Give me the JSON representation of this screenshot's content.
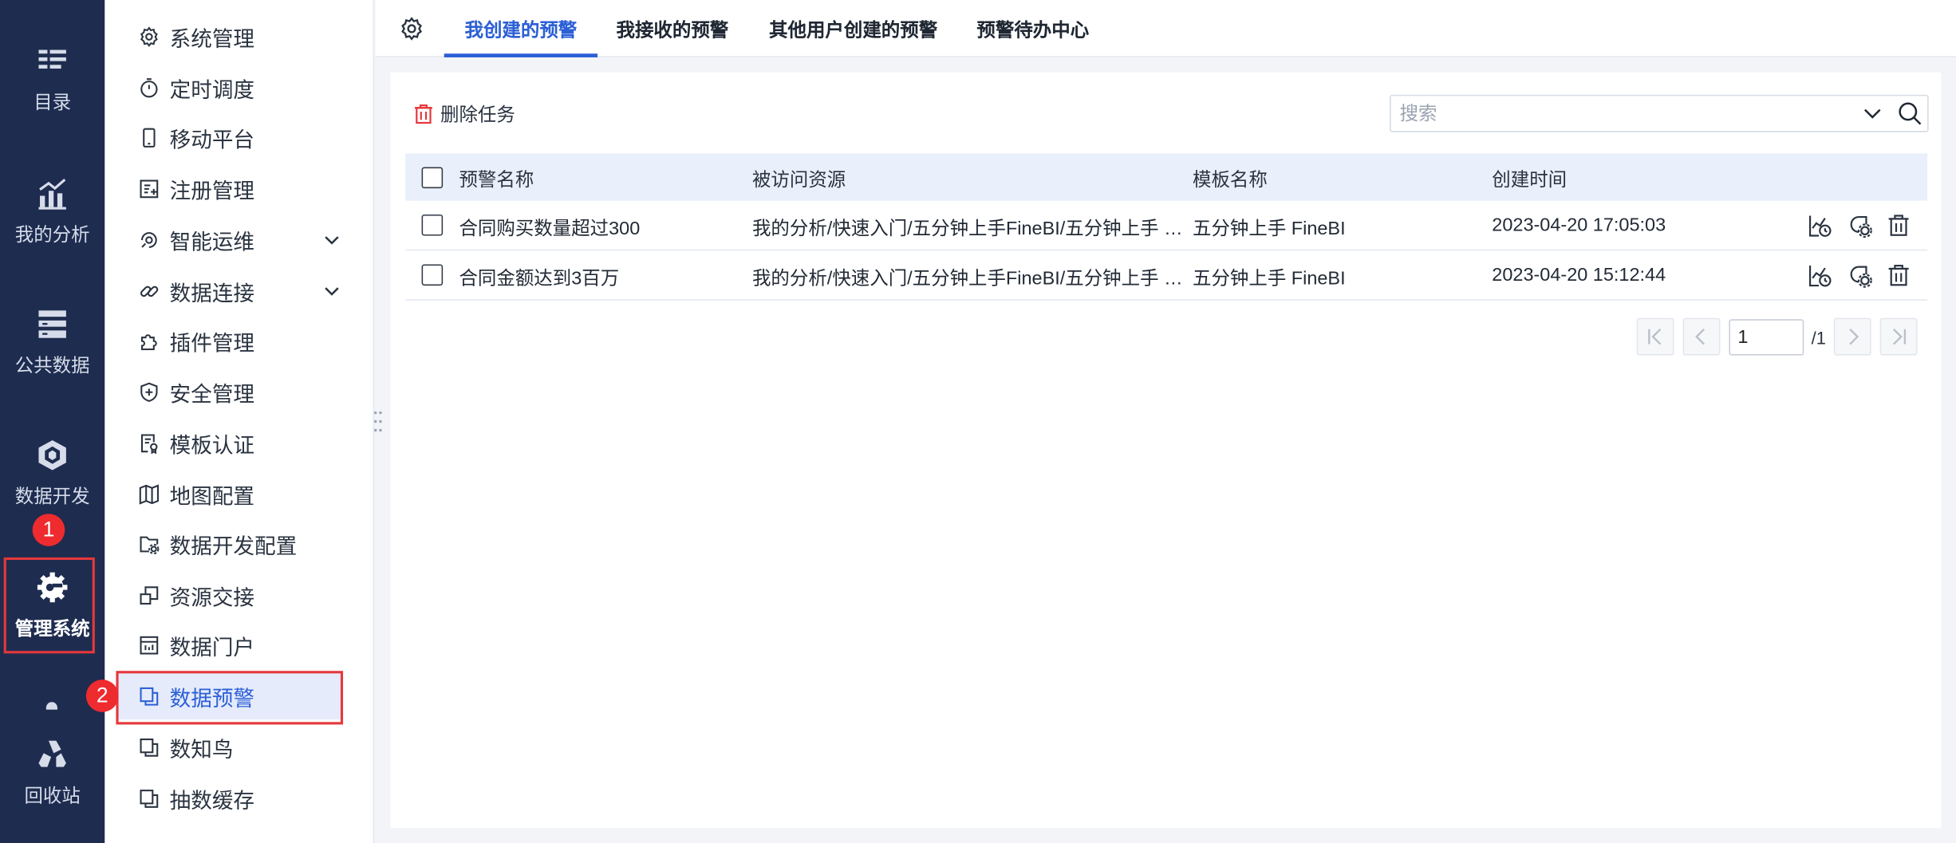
{
  "rail": {
    "items": [
      {
        "label": "目录",
        "icon": "catalog-icon"
      },
      {
        "label": "我的分析",
        "icon": "analysis-icon"
      },
      {
        "label": "公共数据",
        "icon": "public-data-icon"
      },
      {
        "label": "数据开发",
        "icon": "data-dev-icon"
      },
      {
        "label": "管理系统",
        "icon": "gear-system-icon"
      },
      {
        "label": "回收站",
        "icon": "recycle-icon"
      }
    ],
    "active": "管理系统"
  },
  "annotations": {
    "badge1": "1",
    "badge2": "2",
    "color": "#ee2b2f"
  },
  "menu": {
    "items": [
      {
        "label": "系统管理",
        "icon": "gear-icon"
      },
      {
        "label": "定时调度",
        "icon": "stopwatch-icon"
      },
      {
        "label": "移动平台",
        "icon": "mobile-icon"
      },
      {
        "label": "注册管理",
        "icon": "register-icon"
      },
      {
        "label": "智能运维",
        "icon": "ops-icon",
        "expandable": true
      },
      {
        "label": "数据连接",
        "icon": "link-icon",
        "expandable": true
      },
      {
        "label": "插件管理",
        "icon": "plugin-icon"
      },
      {
        "label": "安全管理",
        "icon": "shield-icon"
      },
      {
        "label": "模板认证",
        "icon": "certificate-icon"
      },
      {
        "label": "地图配置",
        "icon": "map-icon"
      },
      {
        "label": "数据开发配置",
        "icon": "folder-gear-icon"
      },
      {
        "label": "资源交接",
        "icon": "handover-icon"
      },
      {
        "label": "数据门户",
        "icon": "portal-icon"
      },
      {
        "label": "数据预警",
        "icon": "copy-icon",
        "active": true
      },
      {
        "label": "数知鸟",
        "icon": "copy-icon"
      },
      {
        "label": "抽数缓存",
        "icon": "copy-icon"
      }
    ]
  },
  "tabs": {
    "items": [
      "我创建的预警",
      "我接收的预警",
      "其他用户创建的预警",
      "预警待办中心"
    ],
    "active": "我创建的预警"
  },
  "toolbar": {
    "delete_label": "删除任务"
  },
  "search": {
    "placeholder": "搜索",
    "value": ""
  },
  "table": {
    "columns": [
      "预警名称",
      "被访问资源",
      "模板名称",
      "创建时间"
    ],
    "rows": [
      {
        "name": "合同购买数量超过300",
        "resource": "我的分析/快速入门/五分钟上手FineBI/五分钟上手 FineBI",
        "template": "五分钟上手 FineBI",
        "created": "2023-04-20 17:05:03"
      },
      {
        "name": "合同金额达到3百万",
        "resource": "我的分析/快速入门/五分钟上手FineBI/五分钟上手 FineBI",
        "template": "五分钟上手 FineBI",
        "created": "2023-04-20 15:12:44"
      }
    ],
    "row_actions": [
      "schedule-icon",
      "edit-icon",
      "trash-icon"
    ]
  },
  "pager": {
    "current": "1",
    "total_label": "/1"
  },
  "colors": {
    "accent": "#2c5fd6",
    "rail_bg": "#1e2c4f",
    "danger": "#e5383b",
    "header_bg": "#e9f0fb"
  }
}
